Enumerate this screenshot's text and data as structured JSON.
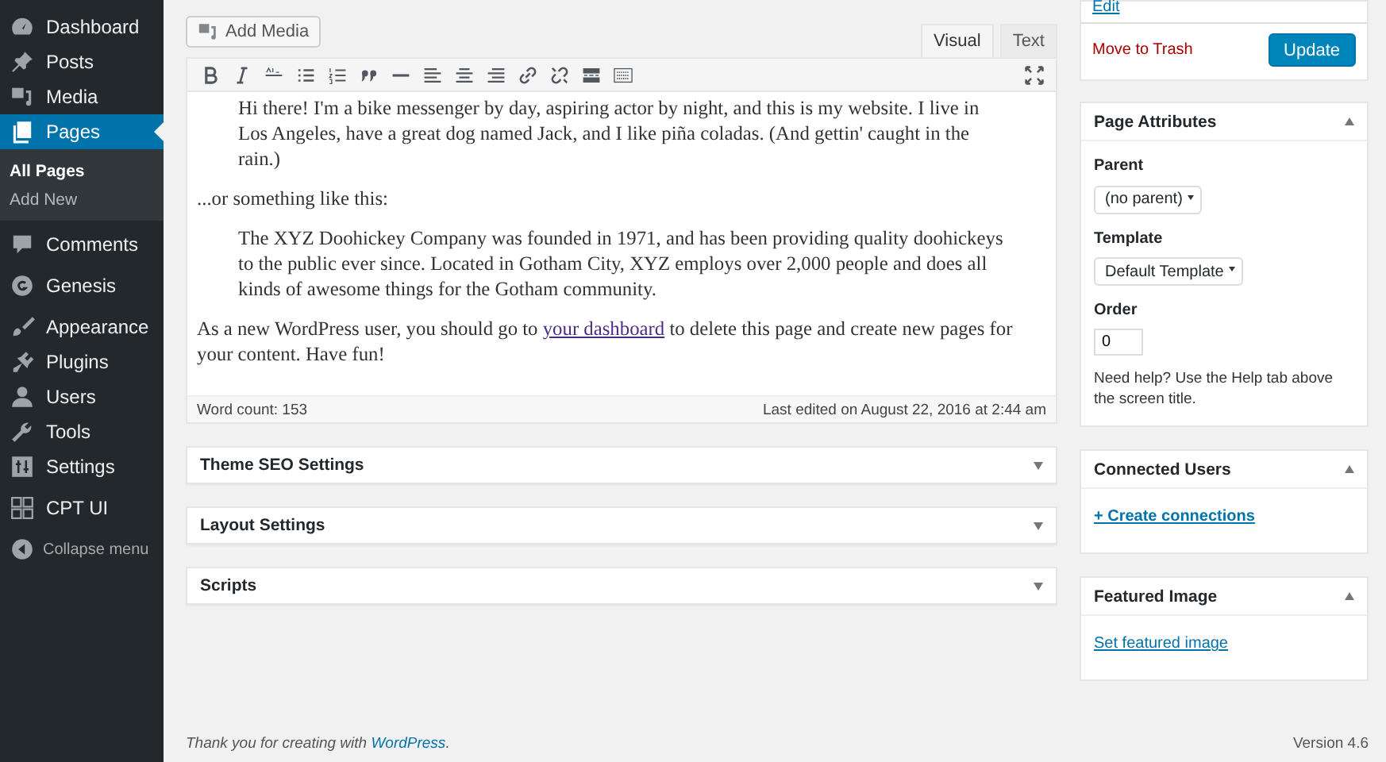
{
  "sidebar": {
    "items": [
      {
        "label": "Dashboard",
        "selected": false
      },
      {
        "label": "Posts",
        "selected": false
      },
      {
        "label": "Media",
        "selected": false
      },
      {
        "label": "Pages",
        "selected": true,
        "children": [
          {
            "label": "All Pages",
            "selected": true
          },
          {
            "label": "Add New",
            "selected": false
          }
        ]
      },
      {
        "label": "Comments",
        "selected": false
      },
      {
        "label": "Genesis",
        "selected": false
      },
      {
        "label": "Appearance",
        "selected": false
      },
      {
        "label": "Plugins",
        "selected": false
      },
      {
        "label": "Users",
        "selected": false
      },
      {
        "label": "Tools",
        "selected": false
      },
      {
        "label": "Settings",
        "selected": false
      },
      {
        "label": "CPT UI",
        "selected": false
      },
      {
        "label": "Collapse menu",
        "selected": false
      }
    ]
  },
  "editor": {
    "add_media": "Add Media",
    "tabs": [
      {
        "label": "Visual",
        "selected": true
      },
      {
        "label": "Text",
        "selected": false
      }
    ],
    "content": [
      {
        "kind": "quote",
        "text": "Hi there! I'm a bike messenger by day, aspiring actor by night, and this is my website. I live in Los Angeles, have a great dog named Jack, and I like piña coladas. (And gettin' caught in the rain.)"
      },
      {
        "kind": "para",
        "text": "...or something like this:"
      },
      {
        "kind": "quote",
        "text": "The XYZ Doohickey Company was founded in 1971, and has been providing quality doohickeys to the public ever since. Located in Gotham City, XYZ employs over 2,000 people and does all kinds of awesome things for the Gotham community."
      },
      {
        "kind": "para",
        "text": "As a new WordPress user, you should go to ",
        "link": "your dashboard",
        "after": " to delete this page and create new pages for your content. Have fun!"
      }
    ],
    "word_count": "Word count: 153",
    "last_edited": "Last edited on August 22, 2016 at 2:44 am"
  },
  "meta_boxes": [
    {
      "title": "Theme SEO Settings",
      "expanded": false
    },
    {
      "title": "Layout Settings",
      "expanded": false
    },
    {
      "title": "Scripts",
      "expanded": false
    }
  ],
  "publish": {
    "edit_link": "Edit",
    "trash": "Move to Trash",
    "update": "Update"
  },
  "page_attributes": {
    "title": "Page Attributes",
    "expanded": true,
    "parent_label": "Parent",
    "parent_value": "(no parent)",
    "template_label": "Template",
    "template_value": "Default Template",
    "order_label": "Order",
    "order_value": "0",
    "help": "Need help? Use the Help tab above the screen title."
  },
  "connected_users": {
    "title": "Connected Users",
    "expanded": true,
    "link": "+ Create connections"
  },
  "featured_image": {
    "title": "Featured Image",
    "expanded": true,
    "link": "Set featured image"
  },
  "footer": {
    "text": "Thank you for creating with ",
    "link": "WordPress",
    "after": ".",
    "version": "Version 4.6"
  }
}
